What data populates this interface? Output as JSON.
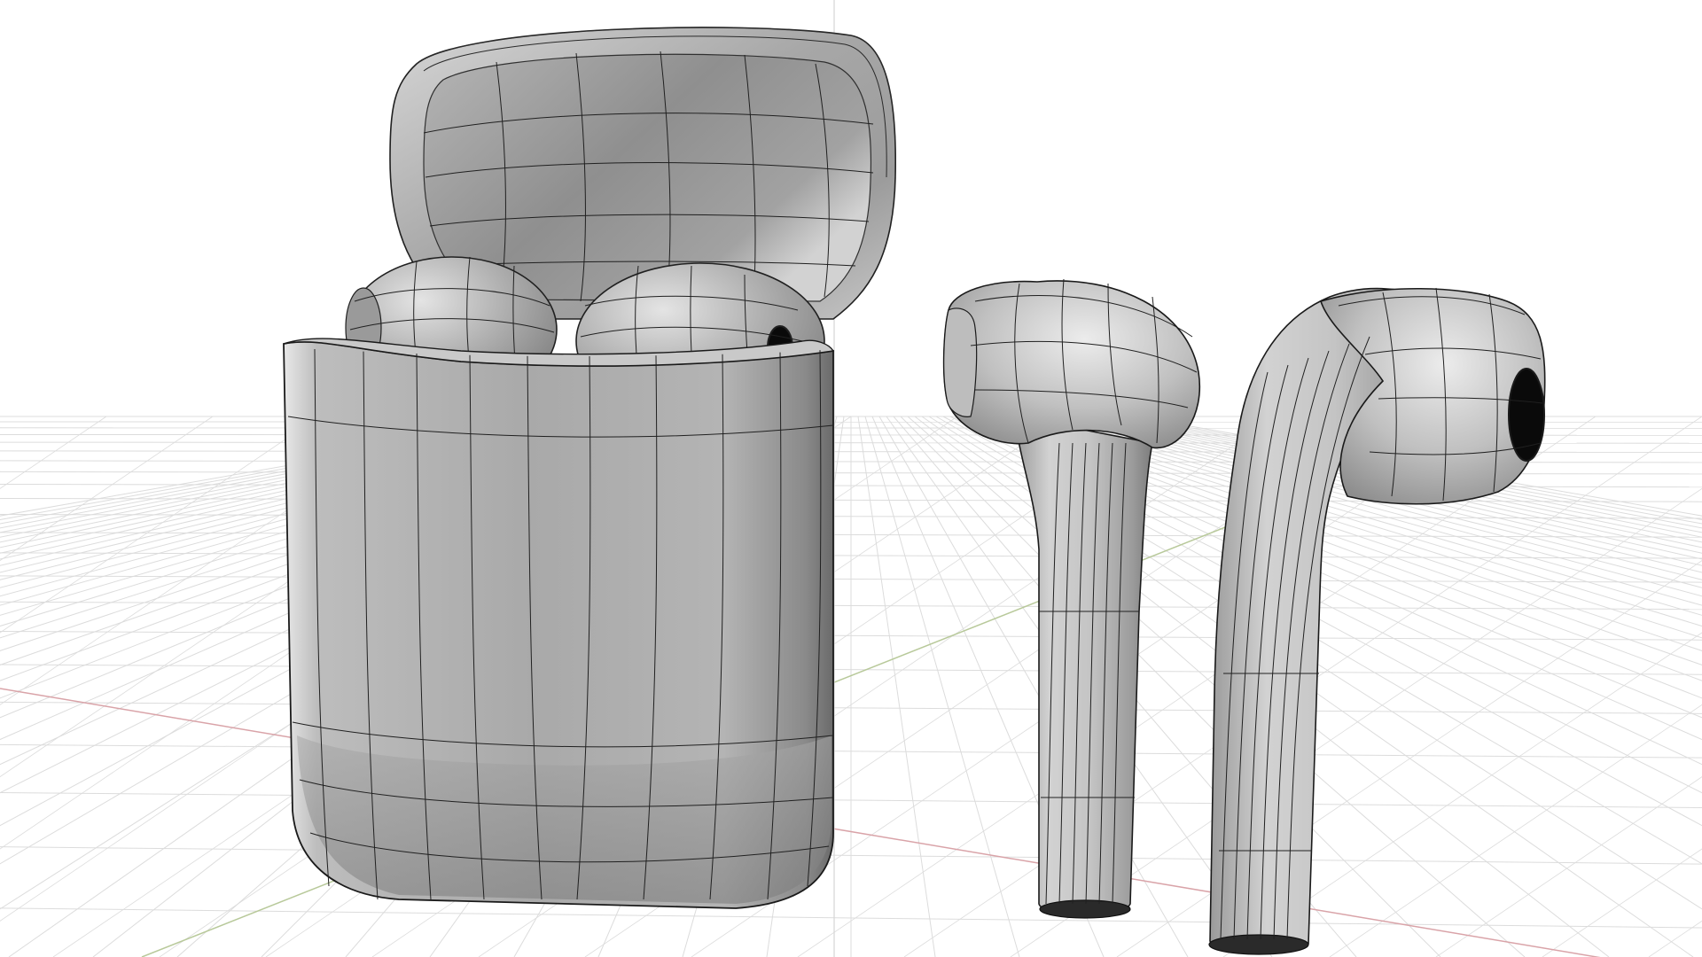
{
  "viewport": {
    "view": "perspective",
    "shading": "shaded-wireframe",
    "grid_visible": true,
    "colors": {
      "background": "#ffffff",
      "grid_line": "#dcdcdc",
      "x_axis": "#d9a3a8",
      "y_axis": "#b8c99a",
      "model_fill": "#aeaeae",
      "model_light": "#dcdcdc",
      "model_dark": "#7c7c7c",
      "wire": "#202020",
      "hole": "#0a0a0a"
    }
  },
  "objects": [
    {
      "name": "case-lid",
      "kind": "surface"
    },
    {
      "name": "case-body",
      "kind": "surface"
    },
    {
      "name": "earbud-in-case-left",
      "kind": "surface"
    },
    {
      "name": "earbud-in-case-right",
      "kind": "surface"
    },
    {
      "name": "earbud-left",
      "kind": "surface"
    },
    {
      "name": "earbud-right",
      "kind": "surface"
    }
  ]
}
